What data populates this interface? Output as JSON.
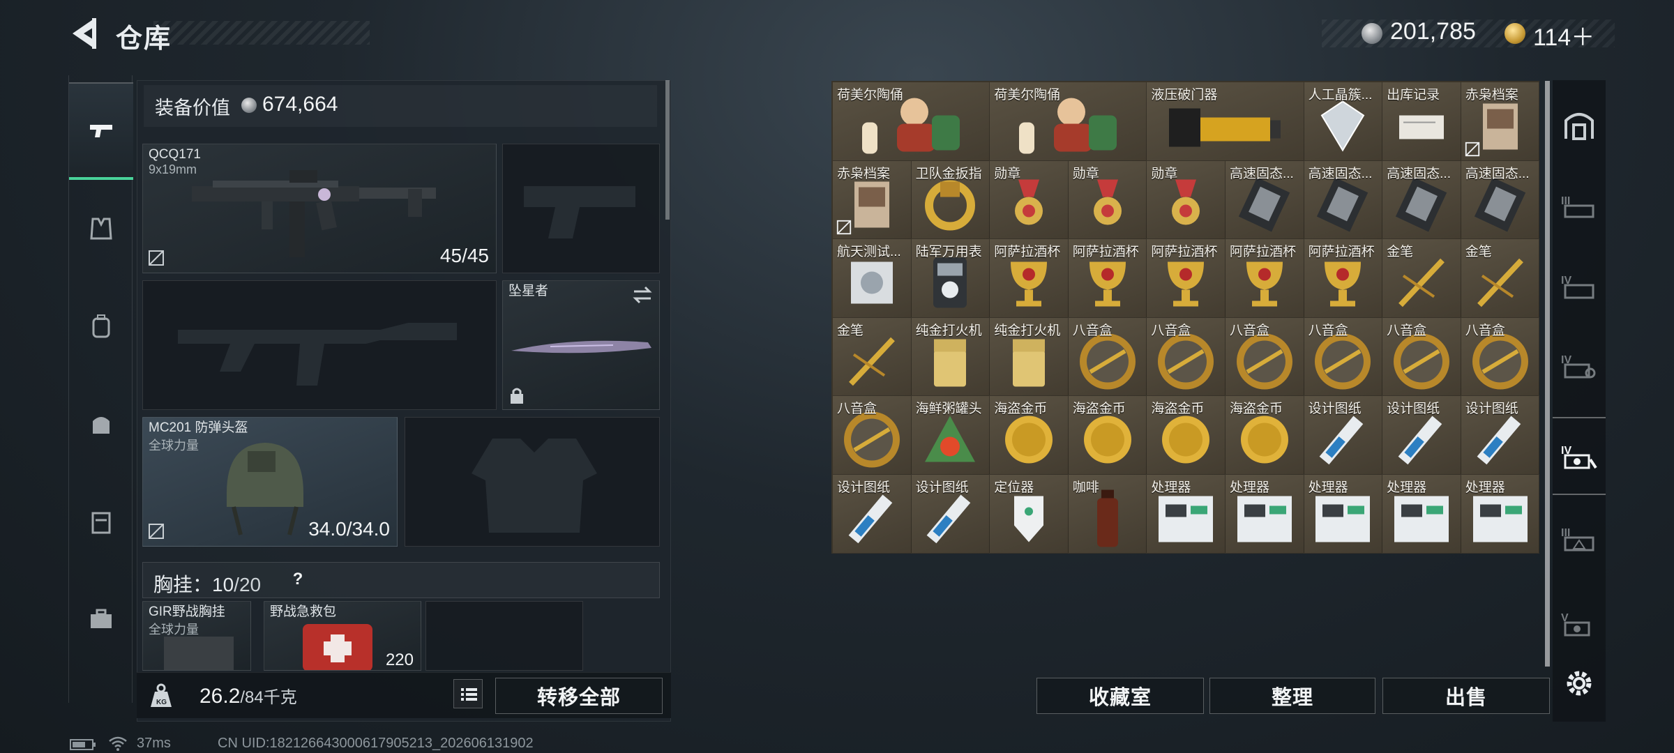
{
  "header": {
    "title": "仓库",
    "currency_silver": "201,785",
    "currency_gold": "114＋"
  },
  "equipment": {
    "value_label": "装备价值",
    "value": "674,664",
    "primary": {
      "name": "QCQ171",
      "sub": "9x19mm",
      "count": "45/45"
    },
    "melee": {
      "name": "坠星者"
    },
    "helmet": {
      "name": "MC201 防弹头盔",
      "sub": "全球力量",
      "count": "34.0/34.0"
    },
    "chest_label": "胸挂：",
    "chest_count": "10",
    "chest_max": "/20",
    "chest_help": "?",
    "chest_rig": {
      "name": "GIR野战胸挂",
      "sub": "全球力量"
    },
    "medkit": {
      "name": "野战急救包",
      "count": "220"
    },
    "weight": "26.2",
    "weight_max": "/84千克",
    "transfer_all": "转移全部"
  },
  "stash": {
    "items": [
      {
        "label": "荷美尔陶俑",
        "icon": "figurine-icon",
        "wide": true
      },
      {
        "label": "荷美尔陶俑",
        "icon": "figurine-icon",
        "wide": true
      },
      {
        "label": "液压破门器",
        "icon": "breacher-icon",
        "wide": true
      },
      {
        "label": "人工晶簇...",
        "icon": "crystal-icon"
      },
      {
        "label": "出库记录",
        "icon": "record-icon"
      },
      {
        "label": "赤枭档案",
        "icon": "dossier-icon",
        "nolock": true
      },
      {
        "label": "赤枭档案",
        "icon": "dossier-icon",
        "nolock": true
      },
      {
        "label": "卫队金扳指",
        "icon": "ring-icon"
      },
      {
        "label": "勋章",
        "icon": "medal-icon"
      },
      {
        "label": "勋章",
        "icon": "medal-icon"
      },
      {
        "label": "勋章",
        "icon": "medal-icon"
      },
      {
        "label": "高速固态...",
        "icon": "ssd-icon"
      },
      {
        "label": "高速固态...",
        "icon": "ssd-icon"
      },
      {
        "label": "高速固态...",
        "icon": "ssd-icon"
      },
      {
        "label": "高速固态...",
        "icon": "ssd-icon"
      },
      {
        "label": "航天测试...",
        "icon": "aero-test-icon"
      },
      {
        "label": "陆军万用表",
        "icon": "multimeter-icon"
      },
      {
        "label": "阿萨拉酒杯",
        "icon": "goblet-icon"
      },
      {
        "label": "阿萨拉酒杯",
        "icon": "goblet-icon"
      },
      {
        "label": "阿萨拉酒杯",
        "icon": "goblet-icon"
      },
      {
        "label": "阿萨拉酒杯",
        "icon": "goblet-icon"
      },
      {
        "label": "阿萨拉酒杯",
        "icon": "goblet-icon"
      },
      {
        "label": "金笔",
        "icon": "gold-pen-icon"
      },
      {
        "label": "金笔",
        "icon": "gold-pen-icon"
      },
      {
        "label": "金笔",
        "icon": "gold-pen-icon"
      },
      {
        "label": "纯金打火机",
        "icon": "lighter-icon"
      },
      {
        "label": "纯金打火机",
        "icon": "lighter-icon"
      },
      {
        "label": "八音盒",
        "icon": "music-box-icon"
      },
      {
        "label": "八音盒",
        "icon": "music-box-icon"
      },
      {
        "label": "八音盒",
        "icon": "music-box-icon"
      },
      {
        "label": "八音盒",
        "icon": "music-box-icon"
      },
      {
        "label": "八音盒",
        "icon": "music-box-icon"
      },
      {
        "label": "八音盒",
        "icon": "music-box-icon"
      },
      {
        "label": "八音盒",
        "icon": "music-box-icon"
      },
      {
        "label": "海鲜粥罐头",
        "icon": "can-icon"
      },
      {
        "label": "海盗金币",
        "icon": "gold-coin-icon"
      },
      {
        "label": "海盗金币",
        "icon": "gold-coin-icon"
      },
      {
        "label": "海盗金币",
        "icon": "gold-coin-icon"
      },
      {
        "label": "海盗金币",
        "icon": "gold-coin-icon"
      },
      {
        "label": "设计图纸",
        "icon": "blueprint-icon"
      },
      {
        "label": "设计图纸",
        "icon": "blueprint-icon"
      },
      {
        "label": "设计图纸",
        "icon": "blueprint-icon"
      },
      {
        "label": "设计图纸",
        "icon": "blueprint-icon"
      },
      {
        "label": "设计图纸",
        "icon": "blueprint-icon"
      },
      {
        "label": "定位器",
        "icon": "locator-icon"
      },
      {
        "label": "咖啡",
        "icon": "coffee-icon"
      },
      {
        "label": "处理器",
        "icon": "processor-icon"
      },
      {
        "label": "处理器",
        "icon": "processor-icon"
      },
      {
        "label": "处理器",
        "icon": "processor-icon"
      },
      {
        "label": "处理器",
        "icon": "processor-icon"
      },
      {
        "label": "处理器",
        "icon": "processor-icon"
      }
    ],
    "btn_collection": "收藏室",
    "btn_sort": "整理",
    "btn_sell": "出售"
  },
  "status_bar": {
    "ping": "37ms",
    "uid": "CN UID:18212664300061790521​3_202606131902"
  },
  "colors": {
    "accent": "#49d39a",
    "stash_bg": "#4d4638"
  }
}
